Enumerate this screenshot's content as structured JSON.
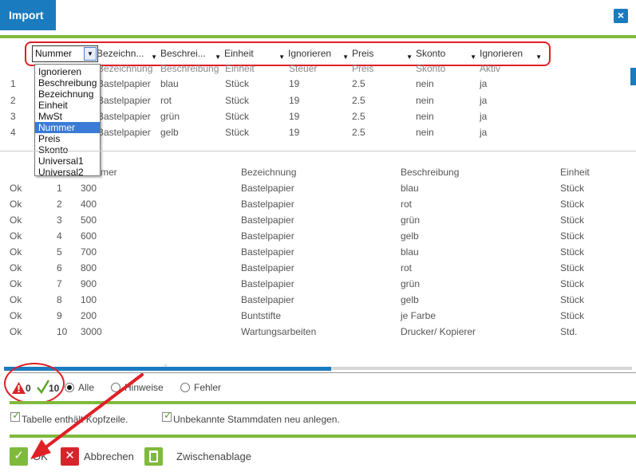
{
  "window": {
    "title": "Import",
    "close_symbol": "×"
  },
  "mapping": {
    "first": {
      "label": "Nummer",
      "arrow": "▼"
    },
    "columns": [
      "Bezeichn...",
      "Beschrei...",
      "Einheit",
      "Ignorieren",
      "Preis",
      "Skonto",
      "Ignorieren"
    ],
    "arrow": "▼",
    "dropdown": {
      "options": [
        "Ignorieren",
        "Beschreibung",
        "Bezeichnung",
        "Einheit",
        "MwSt",
        "Nummer",
        "Preis",
        "Skonto",
        "Universal1",
        "Universal2"
      ],
      "selected": "Nummer"
    }
  },
  "preview": {
    "header": [
      "Bezeichnung",
      "Beschreibung",
      "Einheit",
      "Steuer",
      "Preis",
      "Skonto",
      "Aktiv"
    ],
    "rows": [
      [
        "1",
        "Bastelpapier",
        "blau",
        "Stück",
        "19",
        "2.5",
        "nein",
        "ja"
      ],
      [
        "2",
        "Bastelpapier",
        "rot",
        "Stück",
        "19",
        "2.5",
        "nein",
        "ja"
      ],
      [
        "3",
        "Bastelpapier",
        "grün",
        "Stück",
        "19",
        "2.5",
        "nein",
        "ja"
      ],
      [
        "4",
        "Bastelpapier",
        "gelb",
        "Stück",
        "19",
        "2.5",
        "nein",
        "ja"
      ]
    ]
  },
  "table": {
    "header": [
      "Nummer",
      "Bezeichnung",
      "Beschreibung",
      "Einheit"
    ],
    "header_visible": "mer",
    "rows": [
      [
        "Ok",
        "1",
        "300",
        "Bastelpapier",
        "blau",
        "Stück"
      ],
      [
        "Ok",
        "2",
        "400",
        "Bastelpapier",
        "rot",
        "Stück"
      ],
      [
        "Ok",
        "3",
        "500",
        "Bastelpapier",
        "grün",
        "Stück"
      ],
      [
        "Ok",
        "4",
        "600",
        "Bastelpapier",
        "gelb",
        "Stück"
      ],
      [
        "Ok",
        "5",
        "700",
        "Bastelpapier",
        "blau",
        "Stück"
      ],
      [
        "Ok",
        "6",
        "800",
        "Bastelpapier",
        "rot",
        "Stück"
      ],
      [
        "Ok",
        "7",
        "900",
        "Bastelpapier",
        "grün",
        "Stück"
      ],
      [
        "Ok",
        "8",
        "100",
        "Bastelpapier",
        "gelb",
        "Stück"
      ],
      [
        "Ok",
        "9",
        "200",
        "Buntstifte",
        "je Farbe",
        "Stück"
      ],
      [
        "Ok",
        "10",
        "3000",
        "Wartungsarbeiten",
        "Drucker/ Kopierer",
        "Std."
      ]
    ]
  },
  "filter": {
    "warning_count": "0",
    "ok_count": "10",
    "options": [
      {
        "label": "Alle",
        "selected": true
      },
      {
        "label": "Hinweise",
        "selected": false
      },
      {
        "label": "Fehler",
        "selected": false
      }
    ]
  },
  "options": {
    "header_row": {
      "label": "Tabelle enthält Kopfzeile.",
      "checked": true
    },
    "create_master": {
      "label": "Unbekannte Stammdaten neu anlegen.",
      "checked": true
    }
  },
  "buttons": {
    "ok": "OK",
    "cancel": "Abbrechen",
    "clipboard": "Zwischenablage"
  },
  "colors": {
    "accent": "#1a7bbf",
    "green": "#7fba3c",
    "annotation": "#e01f26",
    "cancel": "#d9232a"
  }
}
